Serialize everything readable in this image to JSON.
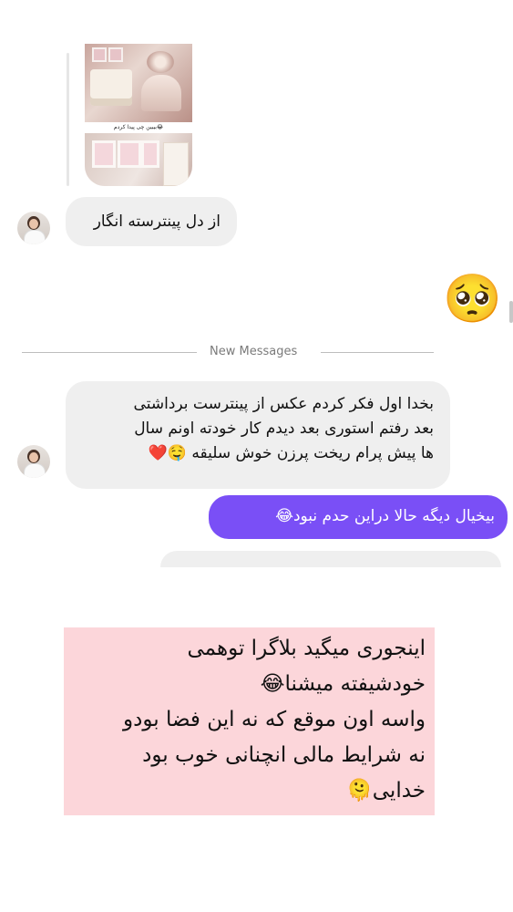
{
  "shared_post": {
    "image_caption": "بیبین چی پیدا کردم😂"
  },
  "messages": [
    {
      "id": "in_1",
      "direction": "incoming",
      "text": "از دل پینترسته انگار"
    },
    {
      "id": "out_emoji",
      "direction": "outgoing",
      "text": "🥺"
    },
    {
      "id": "in_2",
      "direction": "incoming",
      "lines": [
        "بخدا اول فکر کردم عکس از پینترست برداشتی",
        "بعد رفتم استوری بعد دیدم کار خودته اونم سال",
        "ها پیش پرام ریخت پرزن خوش سلیقه 🤤❤️"
      ]
    },
    {
      "id": "out_2",
      "direction": "outgoing",
      "text": "بیخیال دیگه حالا دراین حدم نبود😂"
    }
  ],
  "divider": {
    "label": "New Messages"
  },
  "caption_overlay": {
    "lines": [
      "اینجوری میگید بلاگرا توهمی",
      "خودشیفته میشنا😂",
      "واسه اون موقع که نه این فضا بودو",
      "نه شرایط مالی انچنانی خوب بود",
      "خدایی🫠"
    ]
  },
  "colors": {
    "outgoing_bubble": "#7a4ff6",
    "incoming_bubble": "#efefef",
    "caption_bg": "#fcd6da"
  }
}
